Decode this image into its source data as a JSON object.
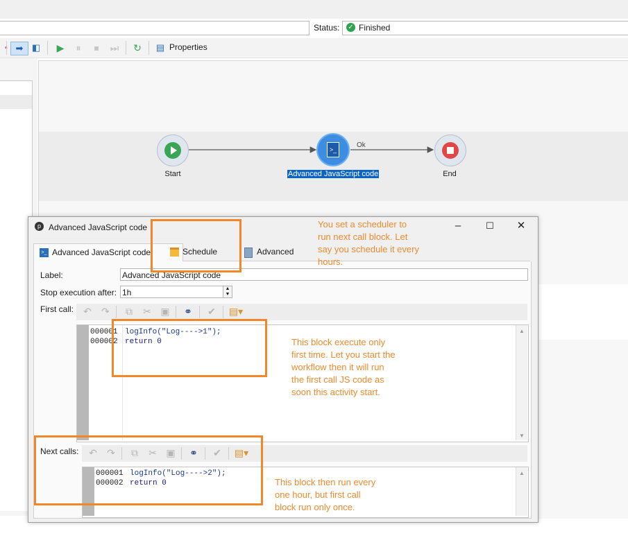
{
  "status": {
    "label": "Status:",
    "value": "Finished",
    "icon": "check-circle-icon",
    "color": "#2fa44f"
  },
  "toolbar": {
    "properties_label": "Properties"
  },
  "workflow": {
    "nodes": [
      {
        "label": "Start",
        "icon": "play-icon"
      },
      {
        "label": "Advanced JavaScript code",
        "icon": "javascript-icon"
      },
      {
        "label": "End",
        "icon": "stop-icon"
      }
    ],
    "transition_label": "Ok"
  },
  "dialog": {
    "title": "Advanced JavaScript code",
    "tabs": [
      {
        "label": "Advanced JavaScript code",
        "icon": "script-icon"
      },
      {
        "label": "Schedule",
        "icon": "calendar-icon"
      },
      {
        "label": "Advanced",
        "icon": "clipboard-icon"
      }
    ],
    "label_field": {
      "label": "Label:",
      "value": "Advanced JavaScript code"
    },
    "stop_field": {
      "label": "Stop execution after:",
      "value": "1h"
    },
    "first_call": {
      "label": "First call:",
      "lines": [
        {
          "num": "000001",
          "code": "logInfo(\"Log---->1\");"
        },
        {
          "num": "000002",
          "code": "return 0"
        }
      ]
    },
    "next_calls": {
      "label": "Next calls:",
      "lines": [
        {
          "num": "000001",
          "code": "logInfo(\"Log---->2\");"
        },
        {
          "num": "000002",
          "code": "return 0"
        }
      ]
    }
  },
  "annotations": {
    "schedule": "You set a scheduler to run next call block. Let say you schedule it every hours.",
    "first_call": "This block execute only first time. Let you start the workflow then it will run the first call JS code as soon this activity start.",
    "next_calls": "This block then run every one hour, but first call block run only once."
  },
  "colors": {
    "annotation": "#f2872a",
    "selection": "#0a64c8",
    "node_active": "#3d8ee0"
  }
}
